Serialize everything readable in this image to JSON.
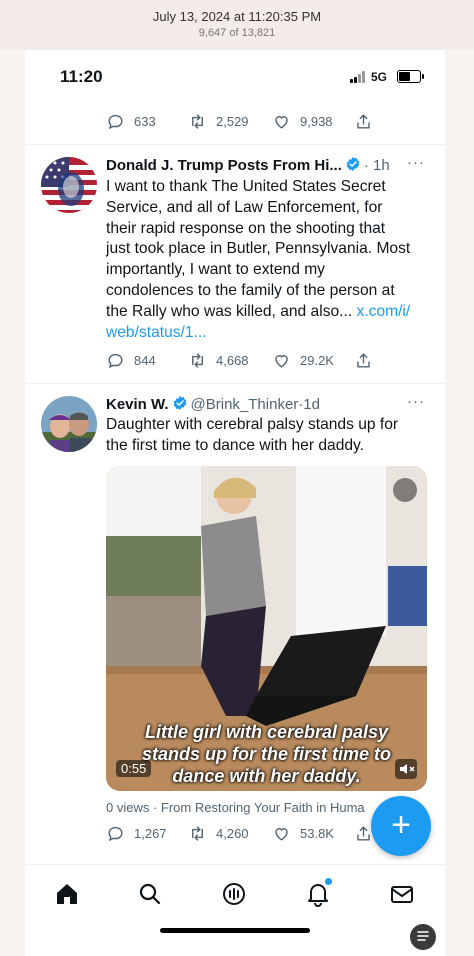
{
  "photo_header": {
    "date": "July 13, 2024 at 11:20:35 PM",
    "count": "9,647 of 13,821"
  },
  "status_bar": {
    "time": "11:20",
    "network": "5G",
    "battery_level": 0.6
  },
  "prev_tweet_actions": {
    "replies": "633",
    "retweets": "2,529",
    "likes": "9,938"
  },
  "tweets": [
    {
      "name": "Donald J. Trump Posts From Hi...",
      "separator": "·",
      "time": "1h",
      "more": "···",
      "text_lines": [
        "I want to thank The United States Secret",
        "Service, and all of Law Enforcement, for",
        "their rapid response on the shooting that",
        "just took place in Butler, Pennsylvania. Most",
        "importantly, I want to extend my",
        "condolences to the family of the person at"
      ],
      "text_line7": "the Rally who was killed, and also...",
      "link_part1": "x.com/i/",
      "link_part2": "web/status/1...",
      "replies": "844",
      "retweets": "4,668",
      "likes": "29.2K"
    },
    {
      "name": "Kevin W.",
      "handle": "@Brink_Thinker",
      "separator": "·",
      "time": "1d",
      "more": "···",
      "text_lines": [
        "Daughter with cerebral palsy stands up for",
        "the first time to dance with her daddy."
      ],
      "video": {
        "caption_lines": [
          "Little girl with cerebral palsy",
          "stands up for the first time to",
          "dance with her daddy."
        ],
        "duration": "0:55"
      },
      "views_line": "0 views · From Restoring Your Faith in Huma",
      "replies": "1,267",
      "retweets": "4,260",
      "likes": "53.8K"
    }
  ],
  "fab_label": "+",
  "tabs": [
    "home-icon",
    "search-icon",
    "spaces-icon",
    "bell-icon",
    "mail-icon"
  ],
  "colors": {
    "accent": "#1d9bf0",
    "muted": "#536471"
  }
}
